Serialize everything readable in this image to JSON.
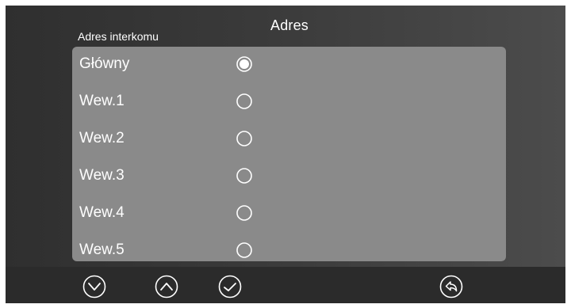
{
  "header": {
    "title": "Adres"
  },
  "section": {
    "label": "Adres interkomu"
  },
  "options": [
    {
      "label": "Główny",
      "selected": true
    },
    {
      "label": "Wew.1",
      "selected": false
    },
    {
      "label": "Wew.2",
      "selected": false
    },
    {
      "label": "Wew.3",
      "selected": false
    },
    {
      "label": "Wew.4",
      "selected": false
    },
    {
      "label": "Wew.5",
      "selected": false
    }
  ],
  "bottom_bar": {
    "buttons": [
      {
        "name": "chevron-down-icon",
        "icon": "chevron-down"
      },
      {
        "name": "chevron-up-icon",
        "icon": "chevron-up"
      },
      {
        "name": "check-icon",
        "icon": "check"
      },
      {
        "name": "back-icon",
        "icon": "back-arrow"
      }
    ]
  },
  "colors": {
    "panel": "#8a8a8a",
    "bottom_bar": "#2b2b2b",
    "text": "#ffffff"
  }
}
